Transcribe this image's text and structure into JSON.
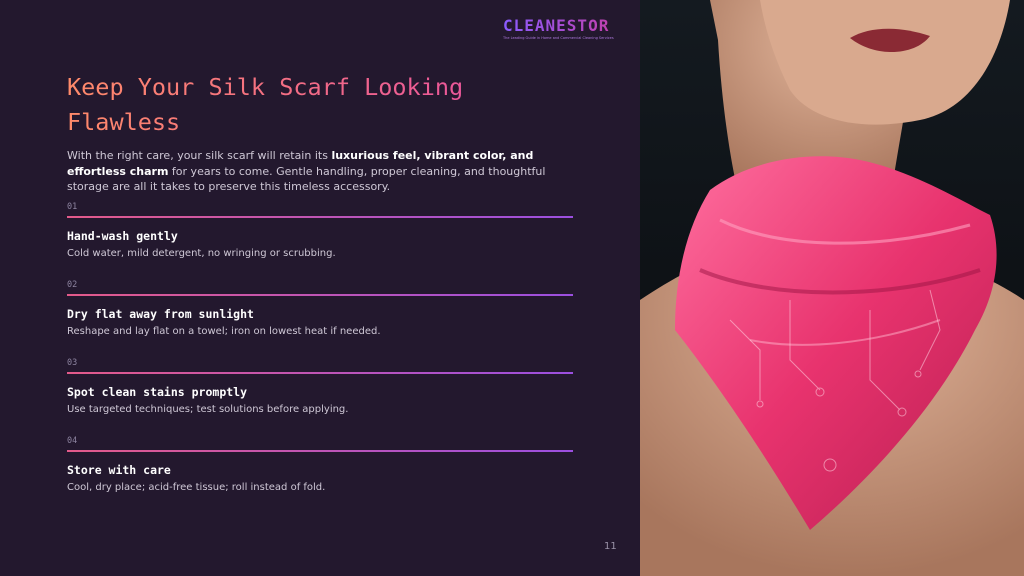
{
  "brand": {
    "name": "CLEANESTOR",
    "tagline": "The Leading Guide in Home and Commercial Cleaning Services"
  },
  "title": "Keep Your Silk Scarf Looking Flawless",
  "intro": {
    "before": "With the right care, your silk scarf will retain its ",
    "bold": "luxurious feel, vibrant color, and effortless charm",
    "after": " for years to come. Gentle handling, proper cleaning, and thoughtful storage are all it takes to preserve this timeless accessory."
  },
  "steps": [
    {
      "num": "01",
      "title": "Hand-wash gently",
      "desc": "Cold water, mild detergent, no wringing or scrubbing."
    },
    {
      "num": "02",
      "title": "Dry flat away from sunlight",
      "desc": "Reshape and lay flat on a towel; iron on lowest heat if needed."
    },
    {
      "num": "03",
      "title": "Spot clean stains promptly",
      "desc": "Use targeted techniques; test solutions before applying."
    },
    {
      "num": "04",
      "title": "Store with care",
      "desc": "Cool, dry place; acid-free tissue; roll instead of fold."
    }
  ],
  "page_number": "11",
  "colors": {
    "background": "#23182e",
    "accent_start": "#e35a8a",
    "accent_end": "#9b4fe0",
    "scarf": "#e8336e"
  }
}
